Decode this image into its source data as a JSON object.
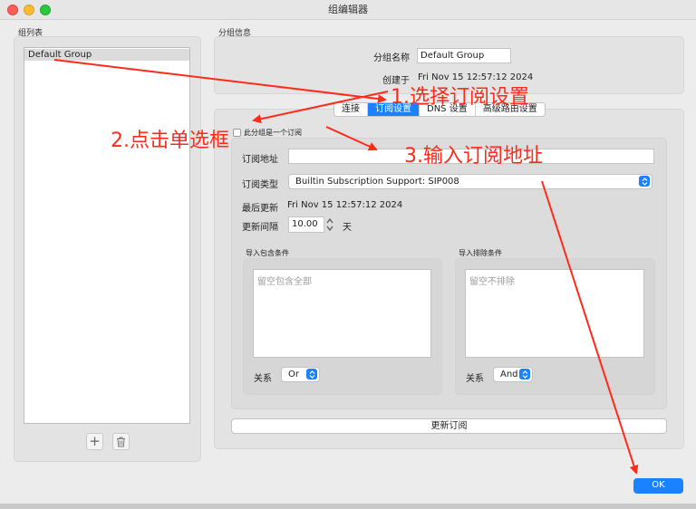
{
  "window": {
    "title": "组编辑器"
  },
  "group_list": {
    "label": "组列表",
    "items": [
      "Default Group"
    ],
    "add_label": "+",
    "delete_icon": "trash-icon"
  },
  "group_info": {
    "label": "分组信息",
    "name_label": "分组名称",
    "name_value": "Default Group",
    "created_label": "创建于",
    "created_value": "Fri Nov 15 12:57:12 2024"
  },
  "tabs": [
    {
      "label": "连接",
      "active": false
    },
    {
      "label": "订阅设置",
      "active": true
    },
    {
      "label": "DNS 设置",
      "active": false
    },
    {
      "label": "高级路由设置",
      "active": false
    }
  ],
  "subscription": {
    "checkbox_label": "此分组是一个订阅",
    "url_label": "订阅地址",
    "url_value": "",
    "type_label": "订阅类型",
    "type_value": "Builtin Subscription Support: SIP008",
    "last_update_label": "最后更新",
    "last_update_value": "Fri Nov 15 12:57:12 2024",
    "interval_label": "更新间隔",
    "interval_value": "10.00",
    "interval_unit": "天",
    "include": {
      "label": "导入包含条件",
      "placeholder": "留空包含全部",
      "relation_label": "关系",
      "relation_value": "Or"
    },
    "exclude": {
      "label": "导入排除条件",
      "placeholder": "留空不排除",
      "relation_label": "关系",
      "relation_value": "And"
    },
    "update_button": "更新订阅"
  },
  "ok_button": "OK",
  "annotations": {
    "step1": "1.选择订阅设置",
    "step2": "2.点击单选框",
    "step3": "3.输入订阅地址"
  },
  "colors": {
    "accent": "#1a82ff",
    "annotation": "#ff2a1a",
    "close": "#ff5f57",
    "minimize": "#febc2e",
    "zoom": "#28c840"
  }
}
